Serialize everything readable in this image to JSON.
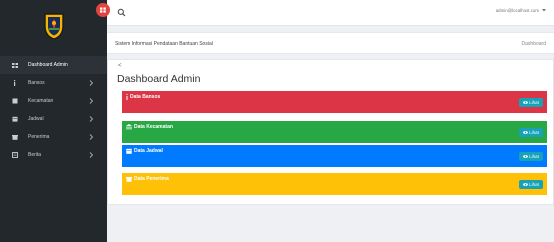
{
  "header": {
    "user_label": "admin@localhost.com"
  },
  "subheader": {
    "app_title": "Sistem Informasi Pendataan Bantuan Sosial",
    "breadcrumb": "Dashboard"
  },
  "sidebar": {
    "items": [
      {
        "label": "Dashboard Admin",
        "icon": "dashboard-icon"
      },
      {
        "label": "Bansos",
        "icon": "info-icon"
      },
      {
        "label": "Kecamatan",
        "icon": "building-icon"
      },
      {
        "label": "Jadwal",
        "icon": "calendar-icon"
      },
      {
        "label": "Penerima",
        "icon": "gift-icon"
      },
      {
        "label": "Berita",
        "icon": "news-icon"
      }
    ]
  },
  "main": {
    "back_label": "<",
    "title": "Dashboard Admin",
    "panels": [
      {
        "title": "Data Bansos",
        "button": "Lihat",
        "color": "#dc3545",
        "icon": "info-icon"
      },
      {
        "title": "Data Kecamatan",
        "button": "Lihat",
        "color": "#28a745",
        "icon": "building-icon"
      },
      {
        "title": "Data Jadwal",
        "button": "Lihat",
        "color": "#007bff",
        "icon": "calendar-icon"
      },
      {
        "title": "Data Penerima",
        "button": "Lihat",
        "color": "#ffc107",
        "icon": "gift-icon"
      }
    ]
  }
}
